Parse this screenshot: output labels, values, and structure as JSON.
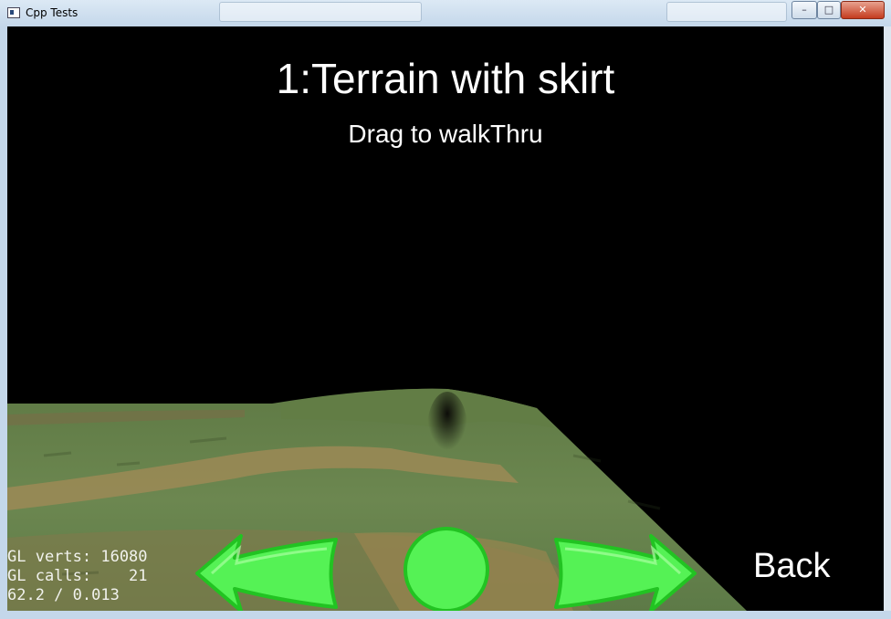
{
  "window": {
    "title": "Cpp Tests",
    "minimize_glyph": "–",
    "maximize_glyph": "□",
    "close_glyph": "✕"
  },
  "scene": {
    "title": "1:Terrain with skirt",
    "subtitle": "Drag to walkThru"
  },
  "stats": {
    "verts": "GL verts: 16080",
    "calls": "GL calls:    21",
    "fps": "62.2 / 0.013"
  },
  "controls": {
    "left_arrow": "left-arrow-icon",
    "center": "circle-icon",
    "right_arrow": "right-arrow-icon",
    "back_label": "Back",
    "accent": "#55f255"
  }
}
